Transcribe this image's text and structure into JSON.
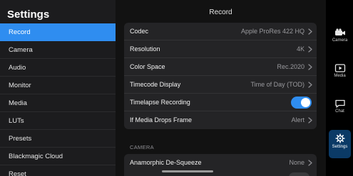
{
  "sidebar": {
    "title": "Settings",
    "items": [
      {
        "label": "Record",
        "active": true
      },
      {
        "label": "Camera"
      },
      {
        "label": "Audio"
      },
      {
        "label": "Monitor"
      },
      {
        "label": "Media"
      },
      {
        "label": "LUTs"
      },
      {
        "label": "Presets"
      },
      {
        "label": "Blackmagic Cloud"
      },
      {
        "label": "Reset"
      }
    ]
  },
  "main": {
    "title": "Record",
    "rows": [
      {
        "label": "Codec",
        "value": "Apple ProRes 422 HQ"
      },
      {
        "label": "Resolution",
        "value": "4K"
      },
      {
        "label": "Color Space",
        "value": "Rec.2020"
      },
      {
        "label": "Timecode Display",
        "value": "Time of Day (TOD)"
      },
      {
        "label": "Timelapse Recording",
        "toggle": "on"
      },
      {
        "label": "If Media Drops Frame",
        "value": "Alert"
      }
    ],
    "section_camera": "CAMERA",
    "camera_rows": [
      {
        "label": "Anamorphic De-Squeeze",
        "value": "None"
      }
    ]
  },
  "tabbar": {
    "tabs": [
      {
        "label": "Camera",
        "icon": "camera-icon"
      },
      {
        "label": "Media",
        "icon": "media-icon"
      },
      {
        "label": "Chat",
        "icon": "chat-icon"
      },
      {
        "label": "Settings",
        "icon": "gear-icon",
        "active": true
      }
    ]
  },
  "colors": {
    "accent": "#2f8df0",
    "active_tab_bg": "#0b3a66",
    "sidebar_bg": "#1c1c1e",
    "group_bg": "#242426"
  }
}
